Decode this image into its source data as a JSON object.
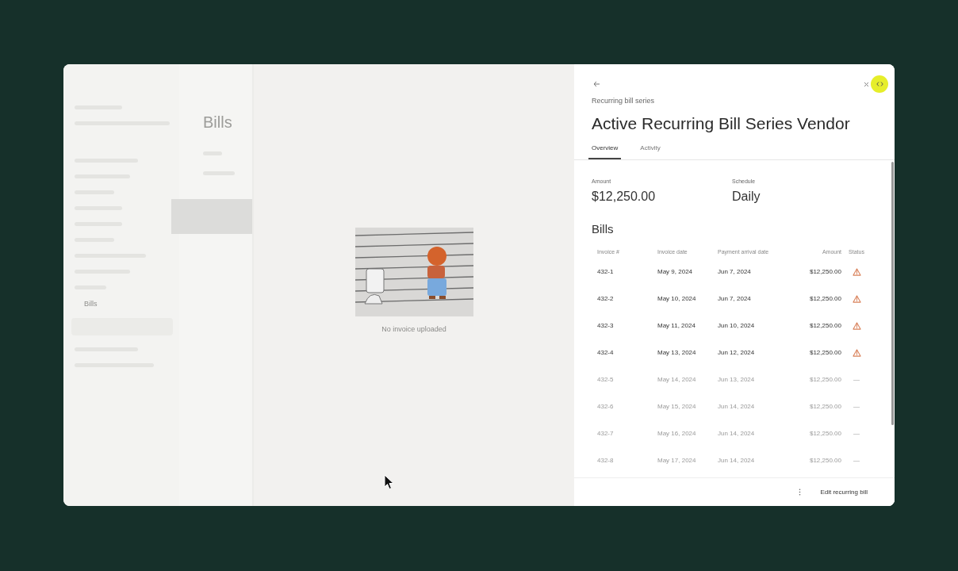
{
  "background_app": {
    "page_title": "Bills",
    "sidebar_selected_item": "Bills"
  },
  "preview": {
    "caption": "No invoice uploaded"
  },
  "panel": {
    "eyebrow": "Recurring bill series",
    "title": "Active Recurring Bill Series Vendor",
    "tabs": [
      {
        "label": "Overview",
        "selected": true
      },
      {
        "label": "Activity",
        "selected": false
      }
    ],
    "summary": [
      {
        "label": "Amount",
        "value": "$12,250.00"
      },
      {
        "label": "Schedule",
        "value": "Daily"
      }
    ],
    "section_title": "Bills",
    "table": {
      "columns": [
        "Invoice #",
        "Invoice date",
        "Payment arrival date",
        "Amount",
        "Status"
      ],
      "rows": [
        {
          "invoice": "432-1",
          "invoice_date": "May 9, 2024",
          "arrival_date": "Jun 7, 2024",
          "amount": "$12,250.00",
          "status": {
            "kind": "warning"
          },
          "muted": false
        },
        {
          "invoice": "432-2",
          "invoice_date": "May 10, 2024",
          "arrival_date": "Jun 7, 2024",
          "amount": "$12,250.00",
          "status": {
            "kind": "warning"
          },
          "muted": false
        },
        {
          "invoice": "432-3",
          "invoice_date": "May 11, 2024",
          "arrival_date": "Jun 10, 2024",
          "amount": "$12,250.00",
          "status": {
            "kind": "warning"
          },
          "muted": false
        },
        {
          "invoice": "432-4",
          "invoice_date": "May 13, 2024",
          "arrival_date": "Jun 12, 2024",
          "amount": "$12,250.00",
          "status": {
            "kind": "warning"
          },
          "muted": false
        },
        {
          "invoice": "432-5",
          "invoice_date": "May 14, 2024",
          "arrival_date": "Jun 13, 2024",
          "amount": "$12,250.00",
          "status": {
            "kind": "text",
            "text": "—"
          },
          "muted": true
        },
        {
          "invoice": "432-6",
          "invoice_date": "May 15, 2024",
          "arrival_date": "Jun 14, 2024",
          "amount": "$12,250.00",
          "status": {
            "kind": "text",
            "text": "—"
          },
          "muted": true
        },
        {
          "invoice": "432-7",
          "invoice_date": "May 16, 2024",
          "arrival_date": "Jun 14, 2024",
          "amount": "$12,250.00",
          "status": {
            "kind": "text",
            "text": "—"
          },
          "muted": true
        },
        {
          "invoice": "432-8",
          "invoice_date": "May 17, 2024",
          "arrival_date": "Jun 14, 2024",
          "amount": "$12,250.00",
          "status": {
            "kind": "text",
            "text": "—"
          },
          "muted": true
        }
      ]
    },
    "footer": {
      "primary_action": "Edit recurring bill"
    }
  }
}
